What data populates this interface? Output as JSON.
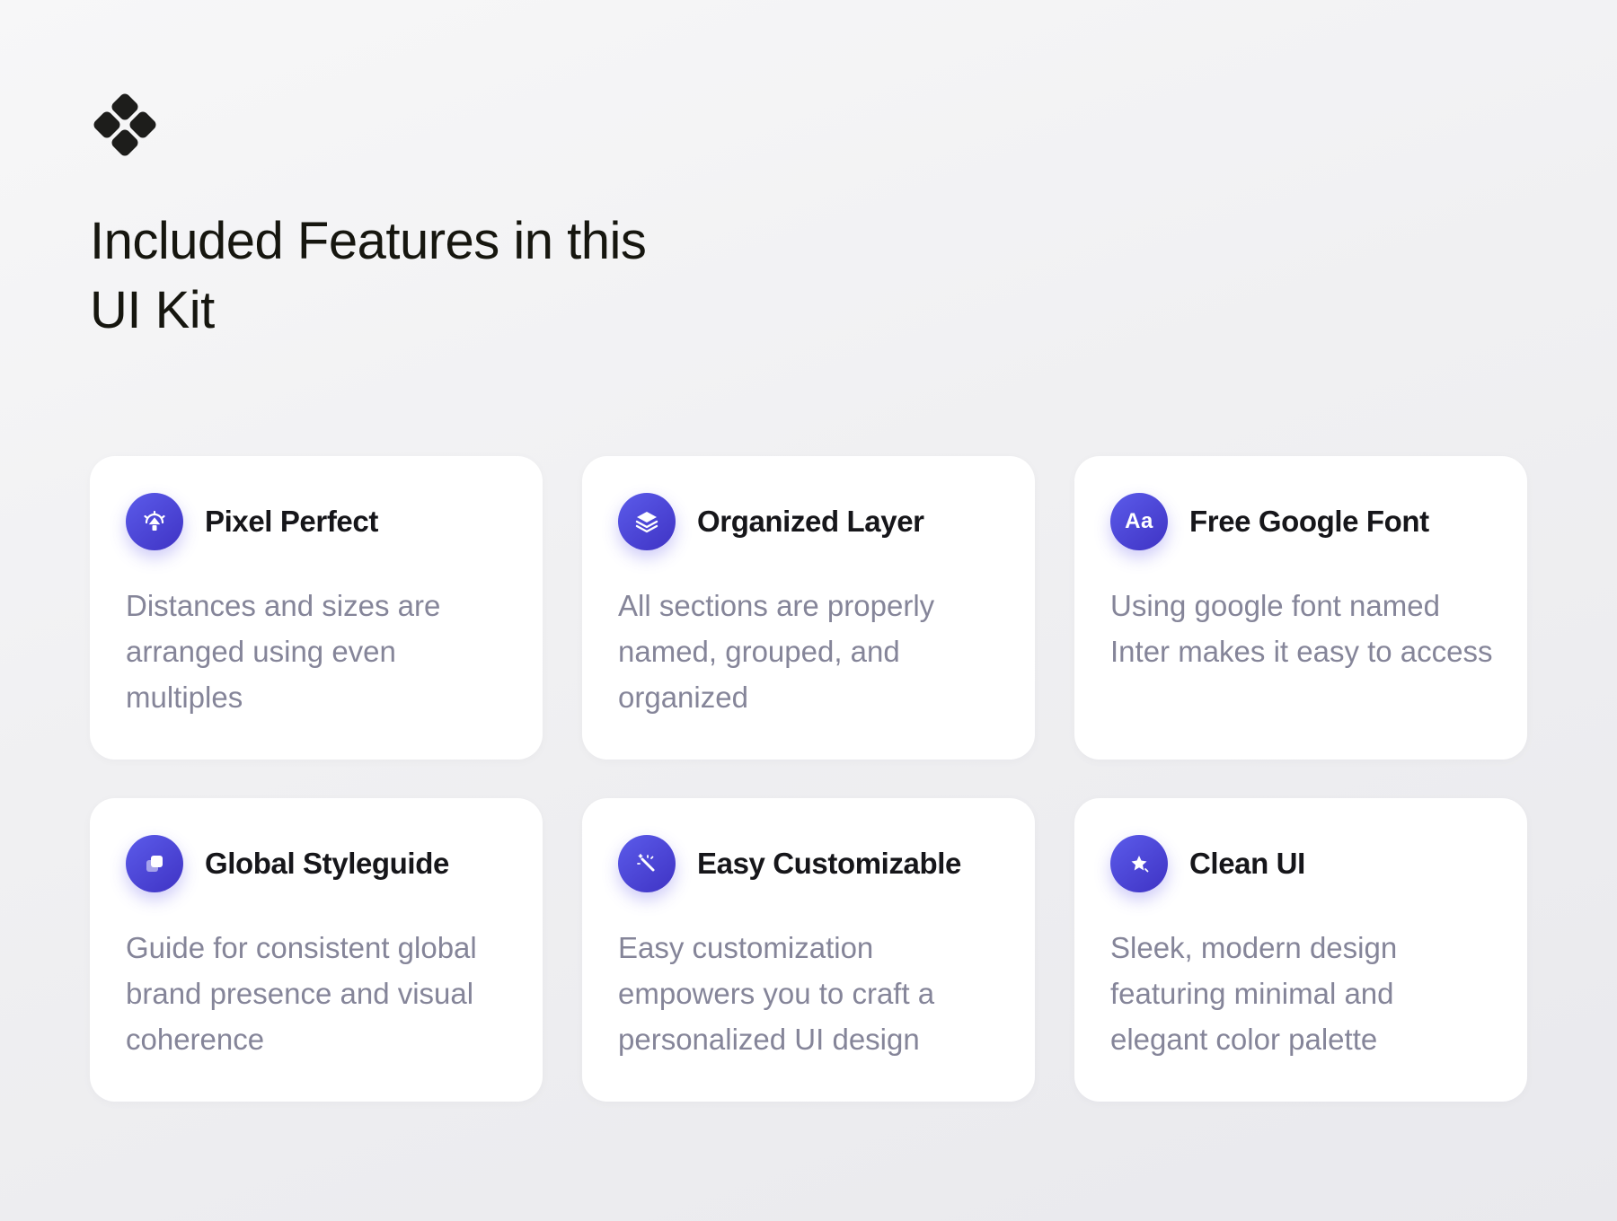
{
  "brand": {
    "logo_icon": "four-diamond-logo-icon",
    "logo_color": "#1d1d1b"
  },
  "headline": "Included Features in this UI Kit",
  "accent_color": "#4f46e5",
  "features": [
    {
      "icon": "pixel-target-icon",
      "title": "Pixel Perfect",
      "description": "Distances and sizes are arranged using even multiples"
    },
    {
      "icon": "layers-icon",
      "title": "Organized Layer",
      "description": "All sections are properly named, grouped, and organized"
    },
    {
      "icon": "font-icon",
      "icon_text": "Aa",
      "title": "Free Google Font",
      "description": "Using google font named Inter makes it easy  to access"
    },
    {
      "icon": "styleguide-squares-icon",
      "title": "Global Styleguide",
      "description": "Guide for consistent global brand presence and visual coherence"
    },
    {
      "icon": "magic-wand-icon",
      "title": "Easy Customizable",
      "description": "Easy customization empowers you to craft a personalized UI design"
    },
    {
      "icon": "sparkle-star-icon",
      "title": "Clean UI",
      "description": "Sleek, modern design featuring minimal and elegant color palette"
    }
  ]
}
